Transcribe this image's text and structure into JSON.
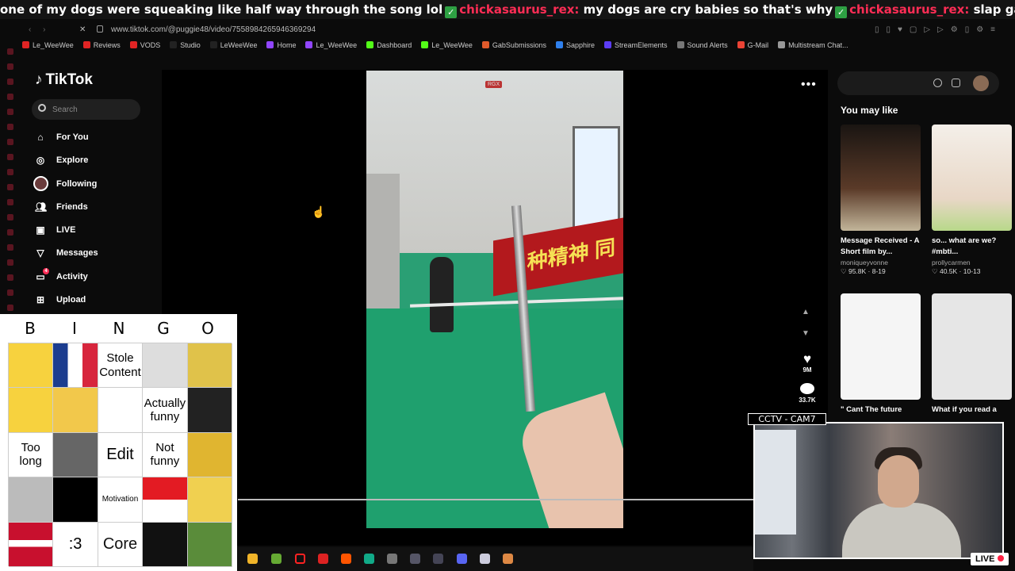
{
  "ticker": {
    "part1": "one of my dogs were squeaking like half way through the song lol",
    "user1": "chickasaurus_rex:",
    "msg1": "my dogs are cry babies so that's why",
    "user2": "chickasaurus_rex:",
    "msg2": "slap game"
  },
  "browser": {
    "url": "www.tiktok.com/@puggie48/video/7558984265946369294",
    "bookmarks": [
      {
        "label": "Le_WeeWee",
        "color": "#e02424"
      },
      {
        "label": "Reviews",
        "color": "#e02424"
      },
      {
        "label": "VODS",
        "color": "#e02424"
      },
      {
        "label": "Studio",
        "color": "#222"
      },
      {
        "label": "LeWeeWee",
        "color": "#222"
      },
      {
        "label": "Home",
        "color": "#9146ff"
      },
      {
        "label": "Le_WeeWee",
        "color": "#9146ff"
      },
      {
        "label": "Dashboard",
        "color": "#53fc18"
      },
      {
        "label": "Le_WeeWee",
        "color": "#53fc18"
      },
      {
        "label": "GabSubmissions",
        "color": "#e05a2b"
      },
      {
        "label": "Sapphire",
        "color": "#2f80ed"
      },
      {
        "label": "StreamElements",
        "color": "#5b3cf5"
      },
      {
        "label": "Sound Alerts",
        "color": "#777"
      },
      {
        "label": "G-Mail",
        "color": "#ea4335"
      },
      {
        "label": "Multistream Chat...",
        "color": "#999"
      }
    ]
  },
  "tiktok": {
    "logo": "TikTok",
    "search_placeholder": "Search",
    "menu": [
      {
        "label": "For You",
        "icon": "home-icon"
      },
      {
        "label": "Explore",
        "icon": "compass-icon"
      },
      {
        "label": "Following",
        "icon": "avatar-icon"
      },
      {
        "label": "Friends",
        "icon": "friends-icon"
      },
      {
        "label": "LIVE",
        "icon": "live-icon"
      },
      {
        "label": "Messages",
        "icon": "send-icon"
      },
      {
        "label": "Activity",
        "icon": "inbox-icon"
      },
      {
        "label": "Upload",
        "icon": "plus-square-icon"
      }
    ],
    "activity_badge": "4",
    "video_label": "RGX",
    "likes": "9M",
    "comments": "33.7K",
    "you_may_like": "You may like",
    "cards": [
      {
        "title": "Message Received - A Short film by...",
        "author": "moniqueyvonne",
        "stats": "♡ 95.8K · 8-19"
      },
      {
        "title": "so... what are we? #mbti...",
        "author": "prollycarmen",
        "stats": "♡ 40.5K · 10-13"
      },
      {
        "title": "\" Cant The future",
        "author": "",
        "stats": ""
      },
      {
        "title": "What if you read a",
        "author": "",
        "stats": ""
      }
    ]
  },
  "bingo": {
    "header": [
      "B",
      "I",
      "N",
      "G",
      "O"
    ],
    "cells": [
      "",
      "",
      "Stole Content",
      "",
      "",
      "",
      "",
      "",
      "Actually funny",
      "",
      "Too long",
      "",
      "Edit",
      "Not funny",
      "",
      "",
      "",
      "Motivation",
      "",
      "",
      "",
      ":3",
      "Core",
      "",
      ""
    ]
  },
  "overlay": {
    "cam_label": "CCTV - CAM7",
    "live": "LIVE"
  }
}
